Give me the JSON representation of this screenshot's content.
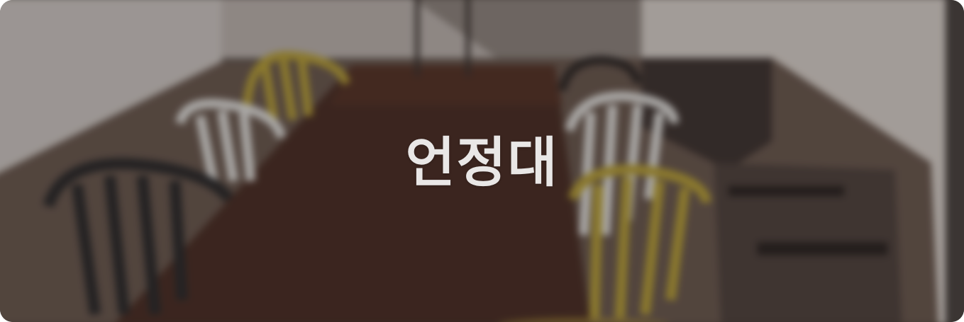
{
  "banner": {
    "title": "언정대"
  },
  "colors": {
    "text": "#e9e7e6",
    "table": "#4a2f26",
    "wall_left": "#cfcac6",
    "wall_right": "#d9d3cd",
    "chair_yellow": "#b8a23a",
    "chair_white": "#e3e3e0",
    "chair_dark": "#2b2b2c"
  }
}
